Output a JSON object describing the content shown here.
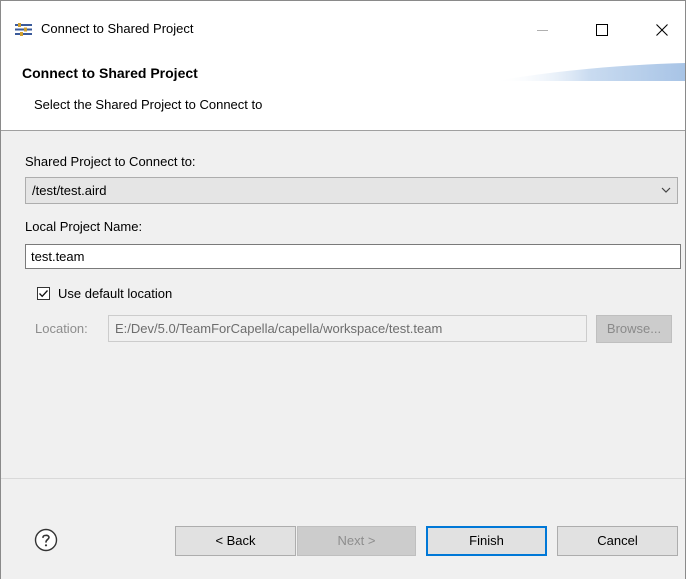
{
  "window": {
    "title": "Connect to Shared Project"
  },
  "banner": {
    "title": "Connect to Shared Project",
    "subtitle": "Select the Shared Project to Connect to"
  },
  "form": {
    "shared_project_label": "Shared Project to Connect to:",
    "shared_project_value": "/test/test.aird",
    "local_name_label": "Local Project Name:",
    "local_name_value": "test.team",
    "use_default_label": "Use default location",
    "use_default_checked": true,
    "location_label": "Location:",
    "location_value": "E:/Dev/5.0/TeamForCapella/capella/workspace/test.team",
    "browse_label": "Browse..."
  },
  "footer": {
    "back_label": "< Back",
    "next_label": "Next >",
    "finish_label": "Finish",
    "cancel_label": "Cancel"
  },
  "icons": {
    "app": "wizard-app-icon",
    "help": "help-icon",
    "dropdown": "chevron-down-icon",
    "check": "check-icon"
  },
  "colors": {
    "focus_border": "#0078d7",
    "dialog_bg": "#f0f0f0",
    "disabled_text": "#8d8d8d"
  }
}
